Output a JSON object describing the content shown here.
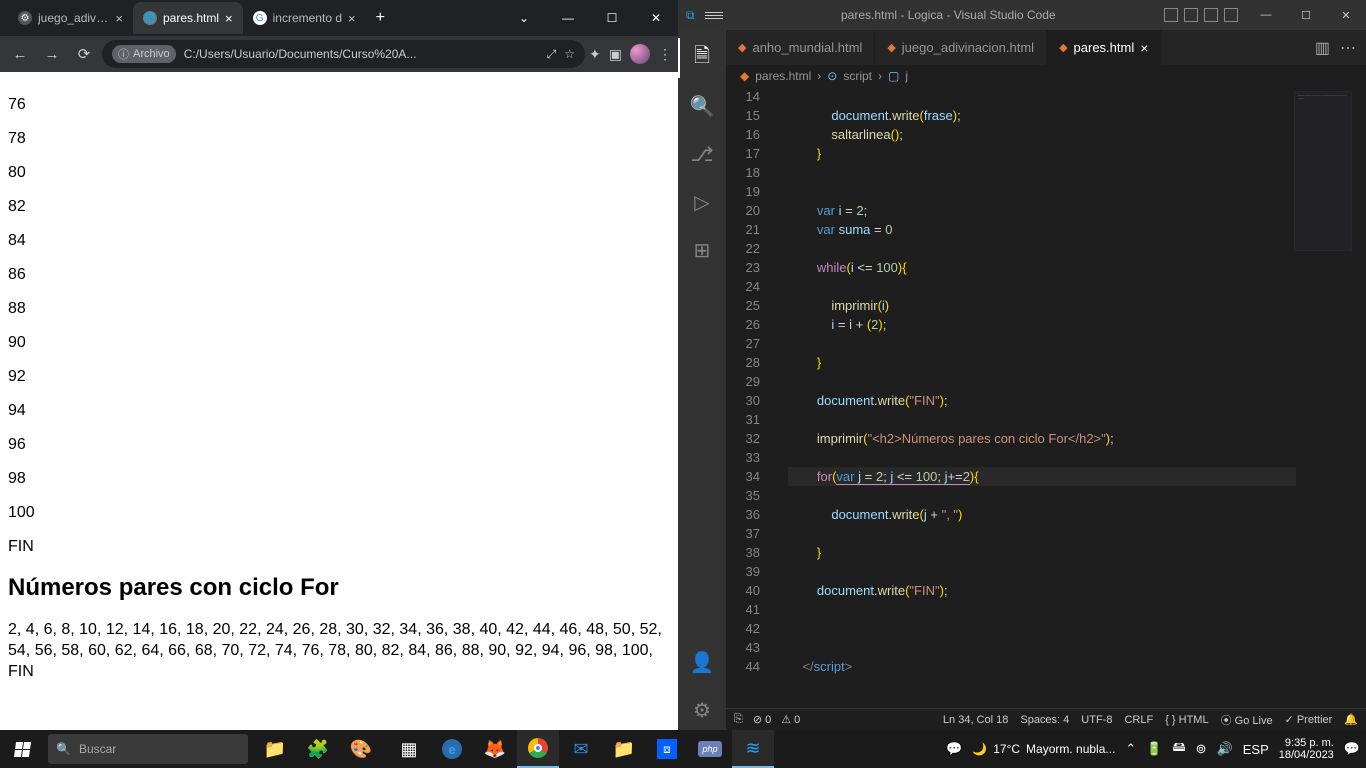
{
  "chrome": {
    "tabs": [
      {
        "label": "juego_adivina",
        "fav": "⚙",
        "favbg": "#555"
      },
      {
        "label": "pares.html",
        "fav": "🌐",
        "favbg": "#777",
        "active": true
      },
      {
        "label": "incremento d",
        "fav": "G",
        "favbg": "#fff"
      }
    ],
    "win": {
      "drop": "⌄",
      "min": "—",
      "max": "☐",
      "close": "✕"
    },
    "nav": {
      "back": "←",
      "fwd": "→",
      "reload": "⟳"
    },
    "info_chip_icon": "ⓘ",
    "info_chip_text": "Archivo",
    "url": "C:/Users/Usuario/Documents/Curso%20A...",
    "right": {
      "trans": "⤢",
      "star": "☆",
      "ext": "✦",
      "tile": "▣",
      "menu": "⋮"
    }
  },
  "page": {
    "nums": [
      "76",
      "78",
      "80",
      "82",
      "84",
      "86",
      "88",
      "90",
      "92",
      "94",
      "96",
      "98",
      "100"
    ],
    "fin": "FIN",
    "h2": "Números pares con ciclo For",
    "inline": "2, 4, 6, 8, 10, 12, 14, 16, 18, 20, 22, 24, 26, 28, 30, 32, 34, 36, 38, 40, 42, 44, 46, 48, 50, 52, 54, 56, 58, 60, 62, 64, 66, 68, 70, 72, 74, 76, 78, 80, 82, 84, 86, 88, 90, 92, 94, 96, 98, 100, FIN"
  },
  "vscode": {
    "title": "pares.html - Logica - Visual Studio Code",
    "win": {
      "min": "—",
      "max": "☐",
      "close": "✕"
    },
    "tabs": [
      {
        "label": "anho_mundial.html"
      },
      {
        "label": "juego_adivinacion.html"
      },
      {
        "label": "pares.html",
        "active": true
      }
    ],
    "breadcrumb": {
      "file": "pares.html",
      "seg1": "script",
      "seg2": "j"
    },
    "lines": [
      {
        "n": 14,
        "html": "        "
      },
      {
        "n": 15,
        "html": "            <span class='v'>document</span><span class='p'>.</span><span class='f'>write</span><span class='b'>(</span><span class='v'>frase</span><span class='b'>)</span><span class='p'>;</span>"
      },
      {
        "n": 16,
        "html": "            <span class='f'>saltarlinea</span><span class='b'>()</span><span class='p'>;</span>"
      },
      {
        "n": 17,
        "html": "        <span class='b'>}</span>"
      },
      {
        "n": 18,
        "html": ""
      },
      {
        "n": 19,
        "html": ""
      },
      {
        "n": 20,
        "html": "        <span class='k'>var</span> <span class='v'>i</span> <span class='p'>=</span> <span class='n'>2</span><span class='p'>;</span>"
      },
      {
        "n": 21,
        "html": "        <span class='k'>var</span> <span class='v'>suma</span> <span class='p'>=</span> <span class='n'>0</span>"
      },
      {
        "n": 22,
        "html": ""
      },
      {
        "n": 23,
        "html": "        <span class='kf'>while</span><span class='b'>(</span><span class='v'>i</span> <span class='p'>&lt;=</span> <span class='n'>100</span><span class='b'>){</span>"
      },
      {
        "n": 24,
        "html": ""
      },
      {
        "n": 25,
        "html": "            <span class='f'>imprimir</span><span class='b'>(</span><span class='v'>i</span><span class='b'>)</span>"
      },
      {
        "n": 26,
        "html": "            <span class='v'>i</span> <span class='p'>=</span> <span class='v'>i</span> <span class='p'>+</span> <span class='b'>(</span><span class='n'>2</span><span class='b'>)</span><span class='p'>;</span>"
      },
      {
        "n": 27,
        "html": ""
      },
      {
        "n": 28,
        "html": "        <span class='b'>}</span>"
      },
      {
        "n": 29,
        "html": ""
      },
      {
        "n": 30,
        "html": "        <span class='v'>document</span><span class='p'>.</span><span class='f'>write</span><span class='b'>(</span><span class='s'>\"FIN\"</span><span class='b'>)</span><span class='p'>;</span>"
      },
      {
        "n": 31,
        "html": ""
      },
      {
        "n": 32,
        "html": "        <span class='f'>imprimir</span><span class='b'>(</span><span class='s'>\"&lt;h2&gt;Números pares con ciclo For&lt;/h2&gt;\"</span><span class='b'>)</span><span class='p'>;</span>"
      },
      {
        "n": 33,
        "html": ""
      },
      {
        "n": 34,
        "html": "        <span class='kf'>for</span><span class='b'>(</span><span class='underline'><span class='k'>var</span> <span class='v'>j</span> <span class='p'>=</span> <span class='n'>2</span><span class='p'>;</span> <span class='v'>j</span> <span class='p'>&lt;=</span> <span class='n'>100</span><span class='p'>;</span> <span class='v'>j</span><span class='p'>+=</span><span class='n'>2</span></span><span class='b'>){</span>",
        "hl": true
      },
      {
        "n": 35,
        "html": ""
      },
      {
        "n": 36,
        "html": "            <span class='v'>document</span><span class='p'>.</span><span class='f'>write</span><span class='b'>(</span><span class='v'>j</span> <span class='p'>+</span> <span class='s'>\", \"</span><span class='b'>)</span>"
      },
      {
        "n": 37,
        "html": ""
      },
      {
        "n": 38,
        "html": "        <span class='b'>}</span>"
      },
      {
        "n": 39,
        "html": ""
      },
      {
        "n": 40,
        "html": "        <span class='v'>document</span><span class='p'>.</span><span class='f'>write</span><span class='b'>(</span><span class='s'>\"FIN\"</span><span class='b'>)</span><span class='p'>;</span>"
      },
      {
        "n": 41,
        "html": ""
      },
      {
        "n": 42,
        "html": ""
      },
      {
        "n": 43,
        "html": ""
      },
      {
        "n": 44,
        "html": "    <span class='t'>&lt;/</span><span class='k'>script</span><span class='t'>&gt;</span>"
      }
    ],
    "status": {
      "remote": "⎘",
      "err": "⊘ 0",
      "warn": "⚠ 0",
      "pos": "Ln 34, Col 18",
      "spaces": "Spaces: 4",
      "enc": "UTF-8",
      "eol": "CRLF",
      "lang": "{ } HTML",
      "live": "⦿ Go Live",
      "prettier": "✓ Prettier",
      "bell": "🔔"
    }
  },
  "taskbar": {
    "search_placeholder": "Buscar",
    "icons": [
      "📁",
      "🧩",
      "🎨"
    ],
    "apps": [
      {
        "glyph": "▦",
        "color": "#fff"
      },
      {
        "glyph": "e",
        "color": "#3aa0e8",
        "bold": true,
        "circle": true
      },
      {
        "glyph": "🦊",
        "color": ""
      },
      {
        "glyph": "●",
        "color": "#4285f4",
        "bg": "#fff",
        "circle": true,
        "active": true,
        "isChrome": true
      },
      {
        "glyph": "✉",
        "color": "#2e8bd8"
      },
      {
        "glyph": "📁",
        "color": "#f6c453"
      },
      {
        "glyph": "⧈",
        "color": "#0061ff",
        "bg": "#0061ff",
        "isDropbox": true
      },
      {
        "glyph": "php",
        "color": "#fff",
        "bg": "#6e81b6",
        "small": true
      },
      {
        "glyph": "≋",
        "color": "#22a6f1",
        "active": true
      }
    ],
    "meet": "💬",
    "weather_icon": "🌙",
    "temp": "17°C",
    "weather_text": "Mayorm. nubla...",
    "tray": {
      "up": "⌃",
      "bat": "🔋",
      "usb": "🖴",
      "net": "⊚",
      "vol": "🔊",
      "lang": "ESP"
    },
    "time": "9:35 p. m.",
    "date": "18/04/2023",
    "notif": "💬"
  }
}
